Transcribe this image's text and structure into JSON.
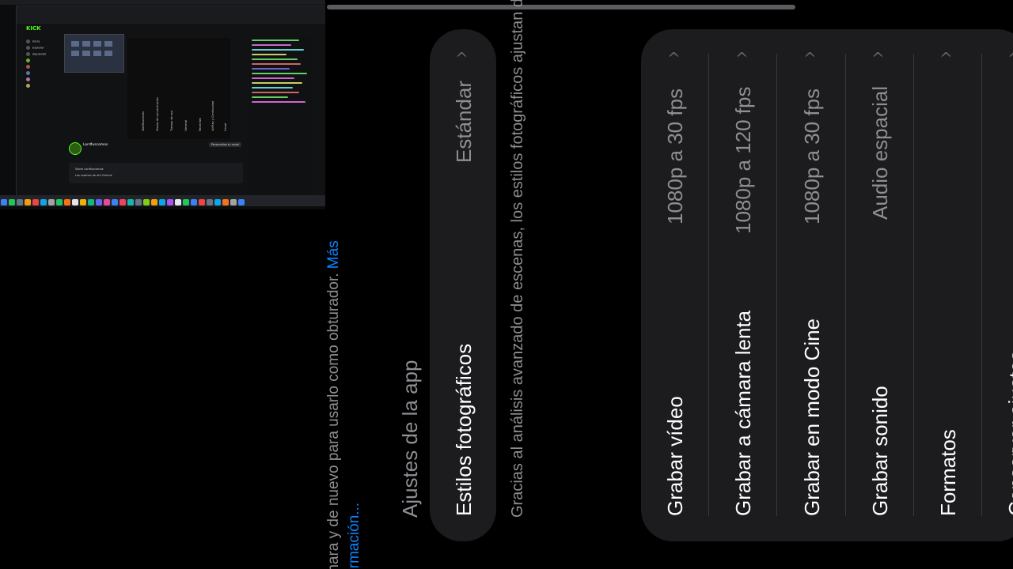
{
  "mini_screenshot": {
    "logo": "KICK",
    "nav": [
      "Inicio",
      "Explorar",
      "Siguiendo"
    ],
    "profile_name": "Lordfuscomos",
    "profile_button": "Personaliza tu canal",
    "about_title": "Sobre Lordfuscomos",
    "about_text": "Los usamos de ahí Chemis",
    "side_menu": [
      "Notificaciones",
      "Modos de concentración",
      "Tiempo de uso",
      "General",
      "Recientes",
      "AirPlay y Continuidad",
      "Canal"
    ]
  },
  "settings": {
    "intro_line1": "cámara y de nuevo para usarlo como obturador.",
    "intro_more": "Más",
    "intro_line2": "información...",
    "section_title": "Ajustes de la app",
    "photographic_styles": {
      "label": "Estilos fotográficos",
      "value": "Estándar"
    },
    "styles_description": "Gracias al análisis avanzado de escenas, los estilos fotográficos ajustan determinados colores de distintas partes de la foto y te permiten mostrar los tonos de piel con una gran variedad de matices para obtener el aspecto que buscas.",
    "rows": [
      {
        "label": "Grabar vídeo",
        "value": "1080p a 30 fps"
      },
      {
        "label": "Grabar a cámara lenta",
        "value": "1080p a 120 fps"
      },
      {
        "label": "Grabar en modo Cine",
        "value": "1080p a 30 fps"
      },
      {
        "label": "Grabar sonido",
        "value": "Audio espacial"
      },
      {
        "label": "Formatos",
        "value": ""
      },
      {
        "label": "Conservar ajustes",
        "value": ""
      }
    ],
    "chevron_icon": "chevron-icon",
    "accent_color": "#0a84ff"
  }
}
